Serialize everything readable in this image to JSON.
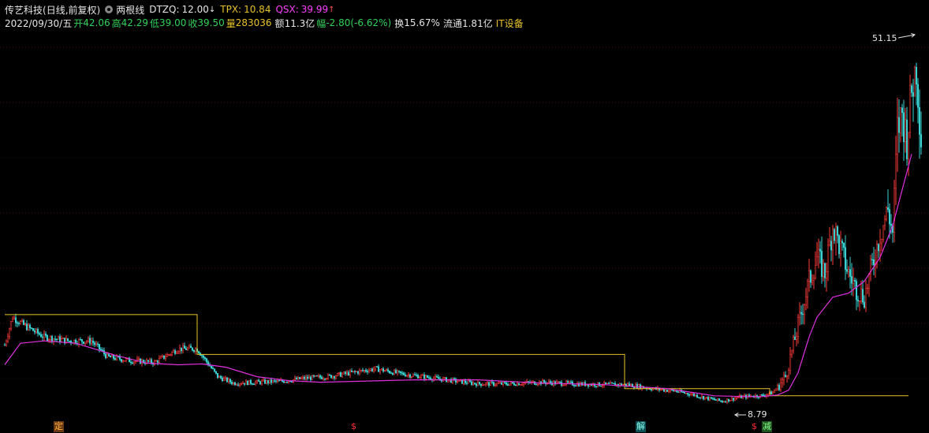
{
  "header": {
    "stock_name": "传艺科技",
    "period": "(日线,前复权)",
    "indicator_name": "两根线",
    "dtzq_label": "DTZQ:",
    "dtzq_value": "12.00",
    "dtzq_arrow": "↓",
    "tpx_label": "TPX:",
    "tpx_value": "10.84",
    "qsx_label": "QSX:",
    "qsx_value": "39.99",
    "qsx_arrow": "↑"
  },
  "info": {
    "date": "2022/09/30/五",
    "open_label": "开",
    "open": "42.06",
    "high_label": "高",
    "high": "42.29",
    "low_label": "低",
    "low": "39.00",
    "close_label": "收",
    "close": "39.50",
    "volume_label": "量",
    "volume": "283036",
    "amount_label": "额",
    "amount": "11.3亿",
    "change_label": "幅",
    "change": "-2.80(-6.62%)",
    "turnover_label": "换",
    "turnover": "15.67%",
    "float_label": "流通",
    "float_value": "1.81亿",
    "sector": "IT设备"
  },
  "annotations": {
    "high_label": "51.15",
    "low_label": "8.79"
  },
  "markers": {
    "ding": "定",
    "s1": "$",
    "jie": "解",
    "s2": "$",
    "jian": "减"
  },
  "colors": {
    "up": "#ff3b3b",
    "down": "#3ad4d4",
    "yellow_line": "#e6c229",
    "magenta_line": "#e030e0"
  },
  "chart_data": {
    "type": "candlestick",
    "y_range": [
      7,
      55
    ],
    "price_anchors": [
      [
        0,
        16
      ],
      [
        5,
        19.5
      ],
      [
        12,
        18.5
      ],
      [
        25,
        17
      ],
      [
        40,
        16.5
      ],
      [
        55,
        16.5
      ],
      [
        65,
        14.5
      ],
      [
        80,
        14
      ],
      [
        95,
        13.8
      ],
      [
        110,
        15.5
      ],
      [
        122,
        15.5
      ],
      [
        135,
        12
      ],
      [
        145,
        11.2
      ],
      [
        160,
        11.3
      ],
      [
        175,
        11.4
      ],
      [
        190,
        11.8
      ],
      [
        205,
        12
      ],
      [
        220,
        12.5
      ],
      [
        235,
        13
      ],
      [
        250,
        12.4
      ],
      [
        265,
        12
      ],
      [
        280,
        11.6
      ],
      [
        300,
        11.1
      ],
      [
        320,
        11.1
      ],
      [
        340,
        11.3
      ],
      [
        360,
        11.1
      ],
      [
        380,
        11
      ],
      [
        395,
        11
      ],
      [
        410,
        10.5
      ],
      [
        425,
        10.2
      ],
      [
        435,
        9.8
      ],
      [
        445,
        9.3
      ],
      [
        455,
        8.9
      ],
      [
        465,
        9.4
      ],
      [
        475,
        9.6
      ],
      [
        480,
        9.6
      ],
      [
        487,
        10
      ],
      [
        495,
        12
      ],
      [
        500,
        16
      ],
      [
        505,
        20
      ],
      [
        510,
        24
      ],
      [
        515,
        27
      ],
      [
        520,
        25
      ],
      [
        525,
        31
      ],
      [
        530,
        28
      ],
      [
        535,
        25
      ],
      [
        540,
        23
      ],
      [
        545,
        22
      ],
      [
        550,
        26
      ],
      [
        555,
        30
      ],
      [
        560,
        33
      ],
      [
        563,
        30
      ],
      [
        566,
        43
      ],
      [
        569,
        45
      ],
      [
        572,
        42
      ],
      [
        575,
        48
      ],
      [
        578,
        51.15
      ],
      [
        581,
        42
      ]
    ],
    "yellow_line_steps": [
      [
        0,
        19.8
      ],
      [
        122,
        19.8
      ],
      [
        122,
        14.8
      ],
      [
        393,
        14.8
      ],
      [
        393,
        10.5
      ],
      [
        485,
        10.5
      ],
      [
        485,
        9.6
      ],
      [
        573,
        9.6
      ]
    ],
    "magenta_line_points": [
      [
        0,
        13.5
      ],
      [
        10,
        16.2
      ],
      [
        25,
        16.5
      ],
      [
        45,
        16.2
      ],
      [
        70,
        14.7
      ],
      [
        90,
        13.7
      ],
      [
        110,
        13.5
      ],
      [
        125,
        13.6
      ],
      [
        140,
        13.2
      ],
      [
        160,
        12
      ],
      [
        180,
        11.5
      ],
      [
        200,
        11.3
      ],
      [
        220,
        11.4
      ],
      [
        260,
        11.6
      ],
      [
        300,
        11.6
      ],
      [
        340,
        11.2
      ],
      [
        380,
        11
      ],
      [
        420,
        10.5
      ],
      [
        450,
        9.6
      ],
      [
        470,
        9.5
      ],
      [
        480,
        9.5
      ],
      [
        490,
        9.7
      ],
      [
        497,
        10.3
      ],
      [
        503,
        12.5
      ],
      [
        510,
        17
      ],
      [
        515,
        19.5
      ],
      [
        525,
        22
      ],
      [
        535,
        22.5
      ],
      [
        545,
        24
      ],
      [
        555,
        27
      ],
      [
        563,
        31
      ],
      [
        571,
        37
      ],
      [
        575,
        39.99
      ]
    ],
    "last_index": 581,
    "high_value": 51.15,
    "low_value": 8.79
  }
}
